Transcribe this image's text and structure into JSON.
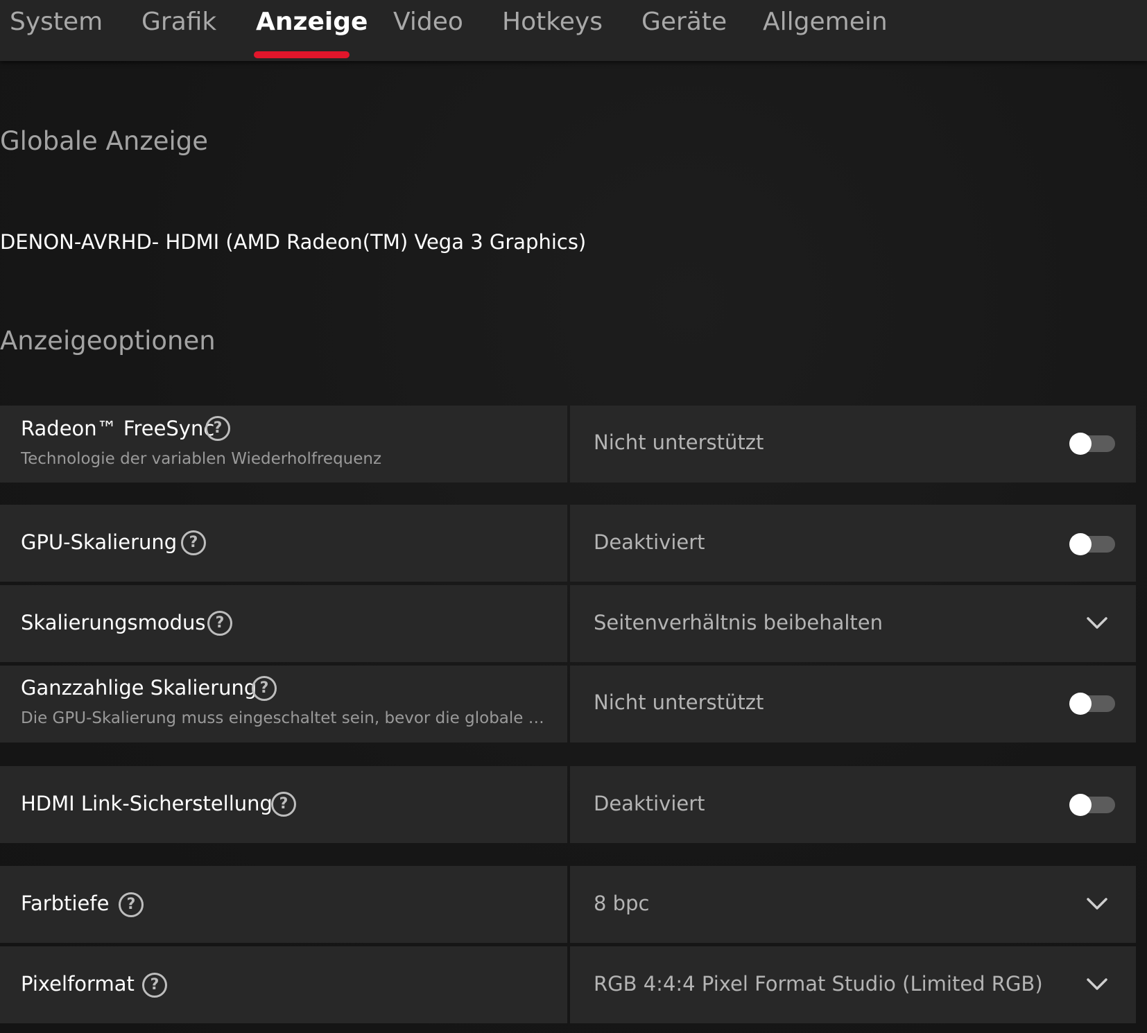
{
  "tabs": [
    {
      "label": "System",
      "active": false
    },
    {
      "label": "Grafik",
      "active": false
    },
    {
      "label": "Anzeige",
      "active": true
    },
    {
      "label": "Video",
      "active": false
    },
    {
      "label": "Hotkeys",
      "active": false
    },
    {
      "label": "Geräte",
      "active": false
    },
    {
      "label": "Allgemein",
      "active": false
    }
  ],
  "global_display": {
    "heading": "Globale Anzeige",
    "display_name": "DENON-AVRHD- HDMI (AMD Radeon(TM) Vega 3 Graphics)"
  },
  "display_options": {
    "heading": "Anzeigeoptionen",
    "settings": [
      {
        "label": "Radeon™ FreeSync",
        "sub": "Technologie der variablen Wiederholfrequenz",
        "value": "Nicht unterstützt",
        "control": "toggle",
        "enabled": false
      },
      {
        "label": "GPU-Skalierung",
        "value": "Deaktiviert",
        "control": "toggle",
        "enabled": false
      },
      {
        "label": "Skalierungsmodus",
        "value": "Seitenverhältnis beibehalten",
        "control": "dropdown"
      },
      {
        "label": "Ganzzahlige Skalierung",
        "sub": "Die GPU-Skalierung muss eingeschaltet sein, bevor die globale u...",
        "value": "Nicht unterstützt",
        "control": "toggle",
        "enabled": false
      },
      {
        "label": "HDMI Link-Sicherstellung",
        "value": "Deaktiviert",
        "control": "toggle",
        "enabled": false
      },
      {
        "label": "Farbtiefe",
        "value": "8 bpc",
        "control": "dropdown"
      },
      {
        "label": "Pixelformat",
        "value": "RGB 4:4:4 Pixel Format Studio (Limited RGB)",
        "control": "dropdown"
      }
    ]
  },
  "icons": {
    "help": "question-circle-icon",
    "dropdown": "chevron-down-icon"
  },
  "colors": {
    "accent": "#e1162b",
    "background": "#181818",
    "tab_bar": "#252525",
    "row": "#282828"
  },
  "help_glyph": "?"
}
